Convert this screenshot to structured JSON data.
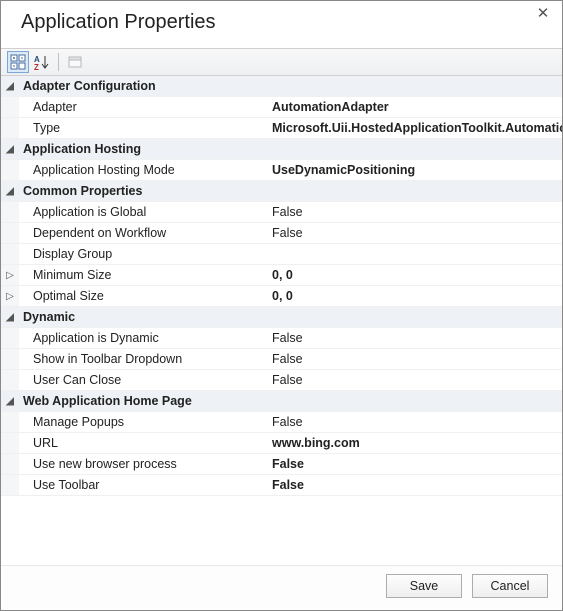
{
  "title": "Application Properties",
  "glyphs": {
    "expanded": "◢",
    "collapsed": "▷"
  },
  "sections": [
    {
      "name": "Adapter Configuration",
      "expanded": true,
      "rows": [
        {
          "label": "Adapter",
          "value": "AutomationAdapter",
          "bold": true
        },
        {
          "label": "Type",
          "value": "Microsoft.Uii.HostedApplicationToolkit.AutomationAdapter",
          "bold": true
        }
      ]
    },
    {
      "name": "Application Hosting",
      "expanded": true,
      "rows": [
        {
          "label": "Application Hosting Mode",
          "value": "UseDynamicPositioning",
          "bold": true
        }
      ]
    },
    {
      "name": "Common Properties",
      "expanded": true,
      "rows": [
        {
          "label": "Application is Global",
          "value": "False"
        },
        {
          "label": "Dependent on Workflow",
          "value": "False"
        },
        {
          "label": "Display Group",
          "value": ""
        },
        {
          "label": "Minimum Size",
          "value": "0, 0",
          "expandable": true,
          "bold": true
        },
        {
          "label": "Optimal Size",
          "value": "0, 0",
          "expandable": true,
          "bold": true
        }
      ]
    },
    {
      "name": "Dynamic",
      "expanded": true,
      "rows": [
        {
          "label": "Application is Dynamic",
          "value": "False"
        },
        {
          "label": "Show in Toolbar Dropdown",
          "value": "False"
        },
        {
          "label": "User Can Close",
          "value": "False"
        }
      ]
    },
    {
      "name": "Web Application Home Page",
      "expanded": true,
      "rows": [
        {
          "label": "Manage Popups",
          "value": "False"
        },
        {
          "label": "URL",
          "value": "www.bing.com",
          "bold": true
        },
        {
          "label": "Use new browser process",
          "value": "False",
          "bold": true
        },
        {
          "label": "Use Toolbar",
          "value": "False",
          "bold": true
        }
      ]
    }
  ],
  "buttons": {
    "save": "Save",
    "cancel": "Cancel"
  }
}
